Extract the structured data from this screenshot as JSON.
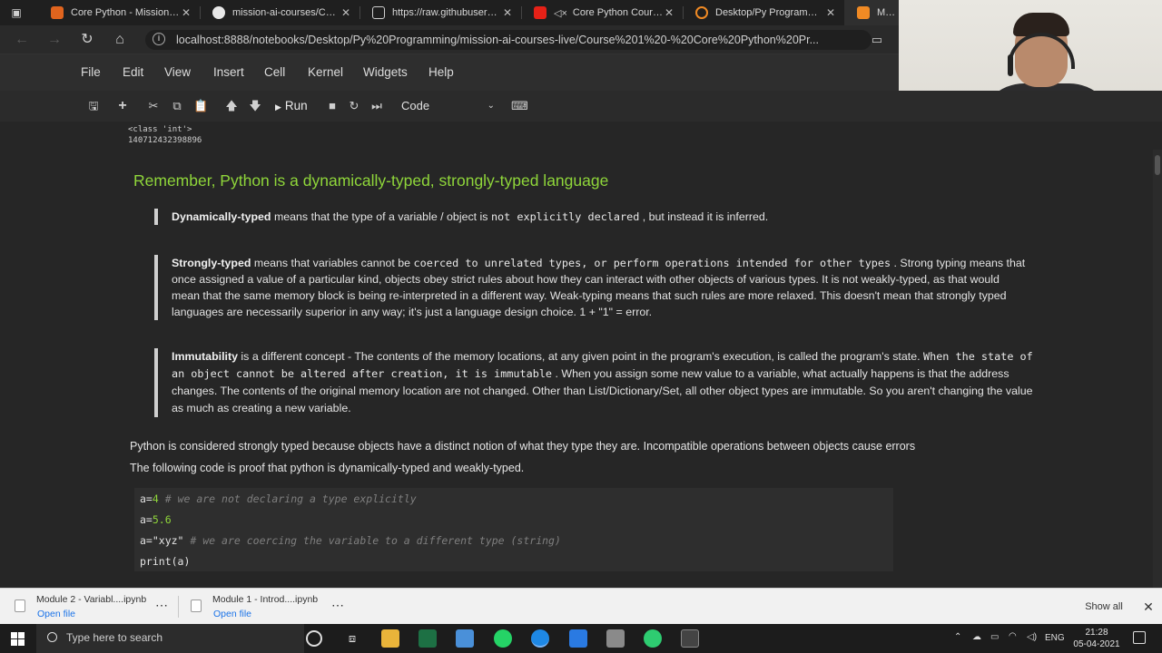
{
  "browser": {
    "tabs": [
      {
        "label": "Core Python - Mission AI",
        "color": "#e0641e"
      },
      {
        "label": "mission-ai-courses/Course",
        "color": "#e8e8e8"
      },
      {
        "label": "https://raw.githubuserconte",
        "color": "#cfcfcf"
      },
      {
        "label": "Core Python Course - ",
        "color": "#e62117"
      },
      {
        "label": "Desktop/Py Programming/",
        "color": "#f08a24"
      },
      {
        "label": "Modul",
        "color": "#f08a24"
      }
    ],
    "url": "localhost:8888/notebooks/Desktop/Py%20Programming/mission-ai-courses-live/Course%201%20-%20Core%20Python%20Pr..."
  },
  "jupyter": {
    "menu": [
      "File",
      "Edit",
      "View",
      "Insert",
      "Cell",
      "Kernel",
      "Widgets",
      "Help"
    ],
    "toolbar": {
      "run_label": "Run",
      "cell_type": "Code"
    }
  },
  "notebook": {
    "prev_output": [
      "<class 'int'>",
      "140712432398896"
    ],
    "heading": "Remember, Python is a dynamically-typed, strongly-typed language",
    "quote1": {
      "bold": "Dynamically-typed",
      "text1": " means that the type of a variable / object is ",
      "code": "not explicitly declared",
      "text2": " , but instead it is inferred."
    },
    "quote2": {
      "bold": "Strongly-typed",
      "text1": " means that variables cannot be ",
      "code": "coerced to unrelated types, or perform operations intended for other types",
      "text2": " . Strong typing means that once assigned a value of a particular kind, objects obey strict rules about how they can interact with other objects of various types. It is not weakly-typed, as that would mean that the same memory block is being re-interpreted in a different way. Weak-typing means that such rules are more relaxed. This doesn't mean that strongly typed languages are necessarily superior in any way; it's just a language design choice. 1 + \"1\" = error."
    },
    "quote3": {
      "bold": "Immutability",
      "text1": " is a different concept - The contents of the memory locations, at any given point in the program's execution, is called the program's state. ",
      "code": "When the state of an object cannot be altered after creation, it is immutable",
      "text2": " . When you assign some new value to a variable, what actually happens is that the address changes. The contents of the original memory location are not changed. Other than List/Dictionary/Set, all other object types are immutable. So you aren't changing the value as much as creating a new variable."
    },
    "para1": "Python is considered strongly typed because objects have a distinct notion of what they type they are. Incompatible operations between objects cause errors",
    "para2": "The following code is proof that python is dynamically-typed and weakly-typed.",
    "code": {
      "l1_var": "a=",
      "l1_val": "4",
      "l1_cmt": " # we are not declaring a type explicitly",
      "l2_var": "a=",
      "l2_val": "5.6",
      "l3_var": "a=",
      "l3_val": "\"xyz\"",
      "l3_cmt": " # we are coercing the variable to a different type (string)",
      "l4": "print(a)"
    }
  },
  "downloads": {
    "items": [
      {
        "name": "Module 2 - Variabl....ipynb",
        "action": "Open file"
      },
      {
        "name": "Module 1 - Introd....ipynb",
        "action": "Open file"
      }
    ],
    "show_all": "Show all"
  },
  "taskbar": {
    "search_placeholder": "Type here to search",
    "language": "ENG",
    "time": "21:28",
    "date": "05-04-2021"
  }
}
